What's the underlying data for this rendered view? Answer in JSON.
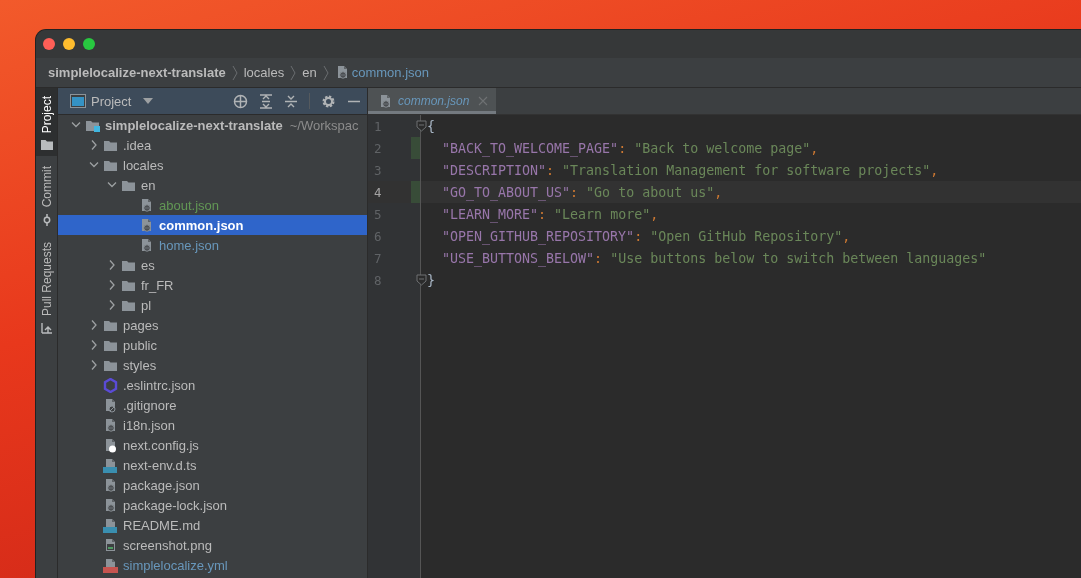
{
  "window": {
    "breadcrumbs": [
      {
        "label": "simplelocalize-next-translate",
        "kind": "project"
      },
      {
        "label": "locales",
        "kind": "folder"
      },
      {
        "label": "en",
        "kind": "folder"
      },
      {
        "label": "common.json",
        "kind": "file"
      }
    ]
  },
  "tool_window_bar": [
    {
      "label": "Project",
      "kind": "project",
      "selected": true
    },
    {
      "label": "Commit",
      "kind": "commit",
      "selected": false
    },
    {
      "label": "Pull Requests",
      "kind": "pull_requests",
      "selected": false
    }
  ],
  "project_panel": {
    "title": "Project",
    "tree": [
      {
        "name": "simplelocalize-next-translate",
        "path": "~/Workspac",
        "kind": "module",
        "expanded": true,
        "selected": false,
        "added": false,
        "modified": false,
        "children": [
          {
            "name": ".idea",
            "kind": "folder",
            "expanded": false,
            "selected": false,
            "added": false,
            "modified": false
          },
          {
            "name": "locales",
            "kind": "folder",
            "expanded": true,
            "selected": false,
            "added": false,
            "modified": false,
            "children": [
              {
                "name": "en",
                "kind": "folder",
                "expanded": true,
                "selected": false,
                "added": false,
                "modified": false,
                "children": [
                  {
                    "name": "about.json",
                    "kind": "json",
                    "selected": false,
                    "added": true,
                    "modified": false
                  },
                  {
                    "name": "common.json",
                    "kind": "json",
                    "selected": true,
                    "added": false,
                    "modified": false
                  },
                  {
                    "name": "home.json",
                    "kind": "json",
                    "selected": false,
                    "added": false,
                    "modified": true
                  }
                ]
              },
              {
                "name": "es",
                "kind": "folder",
                "expanded": false,
                "selected": false,
                "added": false,
                "modified": false
              },
              {
                "name": "fr_FR",
                "kind": "folder",
                "expanded": false,
                "selected": false,
                "added": false,
                "modified": false
              },
              {
                "name": "pl",
                "kind": "folder",
                "expanded": false,
                "selected": false,
                "added": false,
                "modified": false
              }
            ]
          },
          {
            "name": "pages",
            "kind": "folder",
            "expanded": false,
            "selected": false,
            "added": false,
            "modified": false
          },
          {
            "name": "public",
            "kind": "folder",
            "expanded": false,
            "selected": false,
            "added": false,
            "modified": false
          },
          {
            "name": "styles",
            "kind": "folder",
            "expanded": false,
            "selected": false,
            "added": false,
            "modified": false
          },
          {
            "name": ".eslintrc.json",
            "kind": "eslint",
            "selected": false,
            "added": false,
            "modified": false
          },
          {
            "name": ".gitignore",
            "kind": "gitignore",
            "selected": false,
            "added": false,
            "modified": false
          },
          {
            "name": "i18n.json",
            "kind": "json",
            "selected": false,
            "added": false,
            "modified": false
          },
          {
            "name": "next.config.js",
            "kind": "js",
            "selected": false,
            "added": false,
            "modified": false
          },
          {
            "name": "next-env.d.ts",
            "kind": "ts",
            "selected": false,
            "added": false,
            "modified": false
          },
          {
            "name": "package.json",
            "kind": "json",
            "selected": false,
            "added": false,
            "modified": false
          },
          {
            "name": "package-lock.json",
            "kind": "json",
            "selected": false,
            "added": false,
            "modified": false
          },
          {
            "name": "README.md",
            "kind": "md",
            "selected": false,
            "added": false,
            "modified": false
          },
          {
            "name": "screenshot.png",
            "kind": "png",
            "selected": false,
            "added": false,
            "modified": false
          },
          {
            "name": "simplelocalize.yml",
            "kind": "yml",
            "selected": false,
            "added": false,
            "modified": true
          }
        ]
      }
    ]
  },
  "editor": {
    "tab": {
      "label": "common.json",
      "selected": true
    },
    "lines": [
      {
        "number": "1",
        "kind": "brace",
        "current": false,
        "changed": false,
        "fold": true,
        "tokens": [
          {
            "kind": "brace",
            "text": "{"
          }
        ]
      },
      {
        "number": "2",
        "kind": "entry",
        "current": false,
        "changed": true,
        "fold": false,
        "tokens": [
          {
            "kind": "key",
            "text": "\"BACK_TO_WELCOME_PAGE\""
          },
          {
            "kind": "colon",
            "text": ": "
          },
          {
            "kind": "string",
            "text": "\"Back to welcome page\""
          },
          {
            "kind": "comma",
            "text": ","
          }
        ]
      },
      {
        "number": "3",
        "kind": "entry",
        "current": false,
        "changed": false,
        "fold": false,
        "tokens": [
          {
            "kind": "key",
            "text": "\"DESCRIPTION\""
          },
          {
            "kind": "colon",
            "text": ": "
          },
          {
            "kind": "string",
            "text": "\"Translation Management for software projects\""
          },
          {
            "kind": "comma",
            "text": ","
          }
        ]
      },
      {
        "number": "4",
        "kind": "entry",
        "current": true,
        "changed": true,
        "fold": false,
        "tokens": [
          {
            "kind": "key",
            "text": "\"GO_TO_ABOUT_US\""
          },
          {
            "kind": "colon",
            "text": ": "
          },
          {
            "kind": "string",
            "text": "\"Go to about us\""
          },
          {
            "kind": "comma",
            "text": ","
          }
        ]
      },
      {
        "number": "5",
        "kind": "entry",
        "current": false,
        "changed": false,
        "fold": false,
        "tokens": [
          {
            "kind": "key",
            "text": "\"LEARN_MORE\""
          },
          {
            "kind": "colon",
            "text": ": "
          },
          {
            "kind": "string",
            "text": "\"Learn more\""
          },
          {
            "kind": "comma",
            "text": ","
          }
        ]
      },
      {
        "number": "6",
        "kind": "entry",
        "current": false,
        "changed": false,
        "fold": false,
        "tokens": [
          {
            "kind": "key",
            "text": "\"OPEN_GITHUB_REPOSITORY\""
          },
          {
            "kind": "colon",
            "text": ": "
          },
          {
            "kind": "string",
            "text": "\"Open GitHub Repository\""
          },
          {
            "kind": "comma",
            "text": ","
          }
        ]
      },
      {
        "number": "7",
        "kind": "entry",
        "current": false,
        "changed": false,
        "fold": false,
        "tokens": [
          {
            "kind": "key",
            "text": "\"USE_BUTTONS_BELOW\""
          },
          {
            "kind": "colon",
            "text": ": "
          },
          {
            "kind": "string",
            "text": "\"Use buttons below to switch between languages\""
          }
        ]
      },
      {
        "number": "8",
        "kind": "brace",
        "current": false,
        "changed": false,
        "fold": true,
        "tokens": [
          {
            "kind": "brace",
            "text": "}"
          }
        ]
      }
    ]
  }
}
